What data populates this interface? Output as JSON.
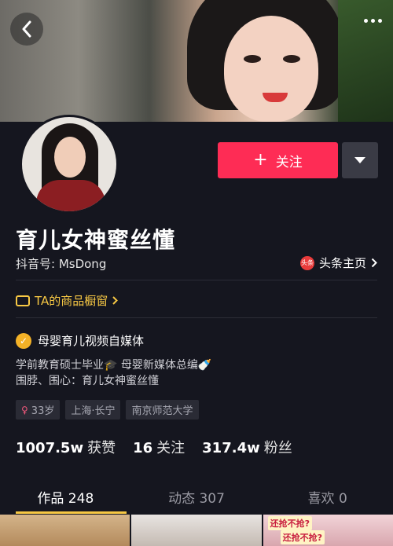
{
  "header": {
    "back_icon": "chevron-left-icon",
    "more_icon": "more-dots-icon"
  },
  "profile": {
    "follow_label": "关注",
    "nickname": "育儿女神蜜丝懂",
    "douyin_id": "抖音号: MsDong",
    "toutiao_badge": "头条",
    "toutiao_label": "头条主页",
    "shop_label": "TA的商品橱窗",
    "verify_label": "母婴育儿视频自媒体",
    "bio_line1": "学前教育硕士毕业🎓 母婴新媒体总编🍼",
    "bio_line2": "围脖、围心：育儿女神蜜丝懂",
    "tags": [
      "33岁",
      "上海·长宁",
      "南京师范大学"
    ],
    "stats": {
      "likes_value": "1007.5w",
      "likes_label": "获赞",
      "following_value": "16",
      "following_label": "关注",
      "followers_value": "317.4w",
      "followers_label": "粉丝"
    }
  },
  "tabs": [
    {
      "label": "作品 248"
    },
    {
      "label": "动态 307"
    },
    {
      "label": "喜欢 0"
    }
  ],
  "thumbs": {
    "third_text_1": "还抢不抢?",
    "third_text_2": "还抢不抢?"
  },
  "colors": {
    "follow_button": "#fe2c55",
    "accent_yellow": "#f7c844",
    "background": "#15161f"
  }
}
